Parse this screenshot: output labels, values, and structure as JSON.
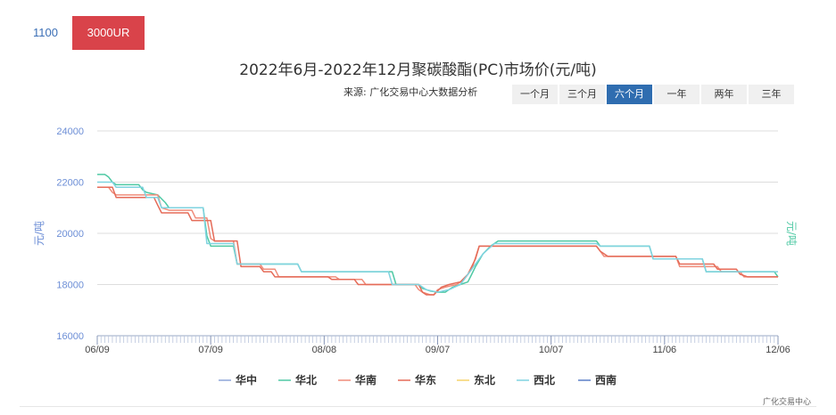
{
  "tabs": [
    {
      "label": "1100",
      "active": false
    },
    {
      "label": "3000UR",
      "active": true
    }
  ],
  "range_buttons": [
    {
      "label": "一个月",
      "active": false
    },
    {
      "label": "三个月",
      "active": false
    },
    {
      "label": "六个月",
      "active": true
    },
    {
      "label": "一年",
      "active": false
    },
    {
      "label": "两年",
      "active": false
    },
    {
      "label": "三年",
      "active": false
    }
  ],
  "watermark": "广化交易中心",
  "colors": {
    "active_tab": "#d9434a",
    "active_range": "#2f6db0",
    "axis_text": "#6c8ed6",
    "grid": "#dddddd"
  },
  "chart_data": {
    "type": "line",
    "title": "2022年6月-2022年12月聚碳酸酯(PC)市场价(元/吨)",
    "subtitle": "来源: 广化交易中心大数据分析",
    "ylabel_left": "元/吨",
    "ylabel_right": "元/吨",
    "ylim": [
      16000,
      24000
    ],
    "yticks": [
      16000,
      18000,
      20000,
      22000,
      24000
    ],
    "xticks": [
      "06/09",
      "07/09",
      "08/08",
      "09/07",
      "10/07",
      "11/06",
      "12/06"
    ],
    "x_range": [
      "2022-06-09",
      "2022-12-06"
    ],
    "grid": true,
    "legend_position": "bottom",
    "series": [
      {
        "name": "华中",
        "color": "#8ea6d8",
        "points": []
      },
      {
        "name": "华北",
        "color": "#4fc9a4",
        "points": [
          [
            "2022-06-09",
            22300
          ],
          [
            "2022-06-11",
            22300
          ],
          [
            "2022-06-12",
            22200
          ],
          [
            "2022-06-13",
            22000
          ],
          [
            "2022-06-14",
            21900
          ],
          [
            "2022-06-20",
            21900
          ],
          [
            "2022-06-21",
            21700
          ],
          [
            "2022-06-22",
            21600
          ],
          [
            "2022-06-25",
            21500
          ],
          [
            "2022-06-27",
            21200
          ],
          [
            "2022-06-28",
            21000
          ],
          [
            "2022-07-07",
            21000
          ],
          [
            "2022-07-08",
            19900
          ],
          [
            "2022-07-09",
            19500
          ],
          [
            "2022-07-15",
            19500
          ],
          [
            "2022-07-16",
            18800
          ],
          [
            "2022-08-01",
            18800
          ],
          [
            "2022-08-02",
            18500
          ],
          [
            "2022-08-26",
            18500
          ],
          [
            "2022-08-27",
            18000
          ],
          [
            "2022-09-02",
            18000
          ],
          [
            "2022-09-03",
            17850
          ],
          [
            "2022-09-05",
            17750
          ],
          [
            "2022-09-07",
            17700
          ],
          [
            "2022-09-09",
            17700
          ],
          [
            "2022-09-10",
            17800
          ],
          [
            "2022-09-11",
            17900
          ],
          [
            "2022-09-13",
            18000
          ],
          [
            "2022-09-15",
            18100
          ],
          [
            "2022-09-16",
            18400
          ],
          [
            "2022-09-17",
            18700
          ],
          [
            "2022-09-19",
            19200
          ],
          [
            "2022-09-21",
            19500
          ],
          [
            "2022-09-23",
            19700
          ],
          [
            "2022-10-19",
            19700
          ],
          [
            "2022-10-20",
            19500
          ],
          [
            "2022-11-02",
            19500
          ],
          [
            "2022-11-03",
            19000
          ],
          [
            "2022-11-16",
            19000
          ],
          [
            "2022-11-17",
            18500
          ],
          [
            "2022-12-05",
            18500
          ],
          [
            "2022-12-06",
            18300
          ]
        ]
      },
      {
        "name": "华南",
        "color": "#f08c7a",
        "points": [
          [
            "2022-06-09",
            21800
          ],
          [
            "2022-06-12",
            21800
          ],
          [
            "2022-06-13",
            21600
          ],
          [
            "2022-06-14",
            21500
          ],
          [
            "2022-06-25",
            21500
          ],
          [
            "2022-06-26",
            21000
          ],
          [
            "2022-06-28",
            20900
          ],
          [
            "2022-07-04",
            20900
          ],
          [
            "2022-07-05",
            20600
          ],
          [
            "2022-07-08",
            20600
          ],
          [
            "2022-07-09",
            19800
          ],
          [
            "2022-07-10",
            19700
          ],
          [
            "2022-07-15",
            19700
          ],
          [
            "2022-07-16",
            18800
          ],
          [
            "2022-07-22",
            18800
          ],
          [
            "2022-07-23",
            18600
          ],
          [
            "2022-07-26",
            18600
          ],
          [
            "2022-07-27",
            18300
          ],
          [
            "2022-08-11",
            18300
          ],
          [
            "2022-08-12",
            18200
          ],
          [
            "2022-08-18",
            18200
          ],
          [
            "2022-08-19",
            18000
          ],
          [
            "2022-09-01",
            18000
          ],
          [
            "2022-09-02",
            17800
          ],
          [
            "2022-09-03",
            17700
          ],
          [
            "2022-09-05",
            17600
          ],
          [
            "2022-09-06",
            17600
          ],
          [
            "2022-09-07",
            17800
          ],
          [
            "2022-09-09",
            17900
          ],
          [
            "2022-09-12",
            18000
          ],
          [
            "2022-09-14",
            18200
          ],
          [
            "2022-09-16",
            18600
          ],
          [
            "2022-09-18",
            19500
          ],
          [
            "2022-10-19",
            19500
          ],
          [
            "2022-10-20",
            19300
          ],
          [
            "2022-10-21",
            19100
          ],
          [
            "2022-11-09",
            19100
          ],
          [
            "2022-11-10",
            18700
          ],
          [
            "2022-11-20",
            18700
          ],
          [
            "2022-11-21",
            18500
          ],
          [
            "2022-11-26",
            18500
          ],
          [
            "2022-11-27",
            18300
          ],
          [
            "2022-12-06",
            18300
          ]
        ]
      },
      {
        "name": "华东",
        "color": "#e56b58",
        "points": [
          [
            "2022-06-09",
            21800
          ],
          [
            "2022-06-13",
            21800
          ],
          [
            "2022-06-14",
            21400
          ],
          [
            "2022-06-24",
            21400
          ],
          [
            "2022-06-25",
            21100
          ],
          [
            "2022-06-26",
            20800
          ],
          [
            "2022-07-03",
            20800
          ],
          [
            "2022-07-04",
            20500
          ],
          [
            "2022-07-09",
            20500
          ],
          [
            "2022-07-10",
            19700
          ],
          [
            "2022-07-16",
            19700
          ],
          [
            "2022-07-17",
            18700
          ],
          [
            "2022-07-22",
            18700
          ],
          [
            "2022-07-23",
            18500
          ],
          [
            "2022-07-25",
            18500
          ],
          [
            "2022-07-26",
            18300
          ],
          [
            "2022-08-09",
            18300
          ],
          [
            "2022-08-10",
            18200
          ],
          [
            "2022-08-16",
            18200
          ],
          [
            "2022-08-17",
            18000
          ],
          [
            "2022-09-02",
            18000
          ],
          [
            "2022-09-03",
            17700
          ],
          [
            "2022-09-04",
            17600
          ],
          [
            "2022-09-06",
            17600
          ],
          [
            "2022-09-08",
            17900
          ],
          [
            "2022-09-10",
            18000
          ],
          [
            "2022-09-13",
            18100
          ],
          [
            "2022-09-15",
            18400
          ],
          [
            "2022-09-17",
            19000
          ],
          [
            "2022-09-18",
            19500
          ],
          [
            "2022-10-19",
            19500
          ],
          [
            "2022-10-20",
            19300
          ],
          [
            "2022-10-22",
            19100
          ],
          [
            "2022-11-09",
            19100
          ],
          [
            "2022-11-10",
            18800
          ],
          [
            "2022-11-19",
            18800
          ],
          [
            "2022-11-20",
            18600
          ],
          [
            "2022-11-25",
            18600
          ],
          [
            "2022-11-26",
            18400
          ],
          [
            "2022-11-28",
            18300
          ],
          [
            "2022-12-06",
            18300
          ]
        ]
      },
      {
        "name": "东北",
        "color": "#f5d36b",
        "points": []
      },
      {
        "name": "西北",
        "color": "#7fd3e0",
        "points": [
          [
            "2022-06-09",
            22000
          ],
          [
            "2022-06-13",
            22000
          ],
          [
            "2022-06-14",
            21800
          ],
          [
            "2022-06-21",
            21800
          ],
          [
            "2022-06-22",
            21400
          ],
          [
            "2022-06-25",
            21400
          ],
          [
            "2022-06-26",
            21000
          ],
          [
            "2022-07-07",
            21000
          ],
          [
            "2022-07-08",
            19600
          ],
          [
            "2022-07-15",
            19600
          ],
          [
            "2022-07-16",
            18800
          ],
          [
            "2022-08-01",
            18800
          ],
          [
            "2022-08-02",
            18500
          ],
          [
            "2022-08-25",
            18500
          ],
          [
            "2022-08-26",
            18000
          ],
          [
            "2022-09-02",
            18000
          ],
          [
            "2022-09-04",
            17800
          ],
          [
            "2022-09-07",
            17700
          ],
          [
            "2022-09-10",
            17800
          ],
          [
            "2022-09-13",
            18000
          ],
          [
            "2022-09-16",
            18600
          ],
          [
            "2022-09-19",
            19200
          ],
          [
            "2022-09-22",
            19600
          ],
          [
            "2022-10-19",
            19600
          ],
          [
            "2022-10-20",
            19500
          ],
          [
            "2022-11-02",
            19500
          ],
          [
            "2022-11-03",
            19000
          ],
          [
            "2022-11-16",
            19000
          ],
          [
            "2022-11-17",
            18500
          ],
          [
            "2022-12-06",
            18500
          ]
        ]
      },
      {
        "name": "西南",
        "color": "#5b7fc7",
        "points": []
      }
    ]
  }
}
